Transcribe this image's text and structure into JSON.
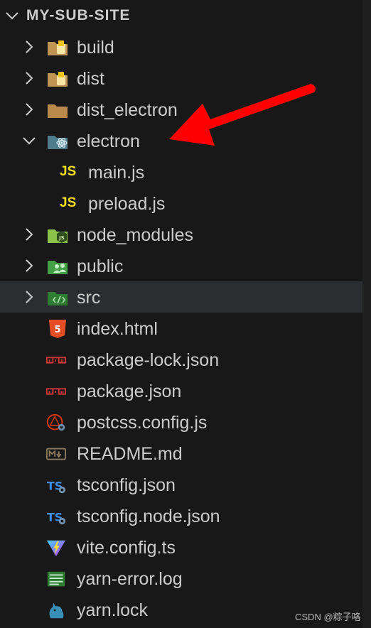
{
  "explorer": {
    "title": "MY-SUB-SITE",
    "items": [
      {
        "label": "build",
        "kind": "folder",
        "expanded": false,
        "icon": "folder-build-icon"
      },
      {
        "label": "dist",
        "kind": "folder",
        "expanded": false,
        "icon": "folder-dist-icon"
      },
      {
        "label": "dist_electron",
        "kind": "folder",
        "expanded": false,
        "icon": "folder-icon"
      },
      {
        "label": "electron",
        "kind": "folder",
        "expanded": true,
        "icon": "folder-electron-icon"
      },
      {
        "label": "main.js",
        "kind": "file",
        "icon": "javascript-icon",
        "icon_text": "JS"
      },
      {
        "label": "preload.js",
        "kind": "file",
        "icon": "javascript-icon",
        "icon_text": "JS"
      },
      {
        "label": "node_modules",
        "kind": "folder",
        "expanded": false,
        "icon": "folder-node-icon"
      },
      {
        "label": "public",
        "kind": "folder",
        "expanded": false,
        "icon": "folder-public-icon"
      },
      {
        "label": "src",
        "kind": "folder",
        "expanded": false,
        "selected": true,
        "icon": "folder-src-icon"
      },
      {
        "label": "index.html",
        "kind": "file",
        "icon": "html5-icon"
      },
      {
        "label": "package-lock.json",
        "kind": "file",
        "icon": "npm-icon"
      },
      {
        "label": "package.json",
        "kind": "file",
        "icon": "npm-icon"
      },
      {
        "label": "postcss.config.js",
        "kind": "file",
        "icon": "postcss-icon"
      },
      {
        "label": "README.md",
        "kind": "file",
        "icon": "markdown-icon"
      },
      {
        "label": "tsconfig.json",
        "kind": "file",
        "icon": "tsconfig-icon"
      },
      {
        "label": "tsconfig.node.json",
        "kind": "file",
        "icon": "tsconfig-icon"
      },
      {
        "label": "vite.config.ts",
        "kind": "file",
        "icon": "vite-icon"
      },
      {
        "label": "yarn-error.log",
        "kind": "file",
        "icon": "log-icon"
      },
      {
        "label": "yarn.lock",
        "kind": "file",
        "icon": "yarn-icon"
      }
    ]
  },
  "annotation": {
    "color": "#ff0000",
    "icon": "red-arrow-annotation"
  },
  "watermark": "CSDN @粽子咯",
  "colors": {
    "background": "#181818",
    "selected_row": "#2b2d31",
    "text": "#cccccc",
    "js_yellow": "#f5de19"
  }
}
